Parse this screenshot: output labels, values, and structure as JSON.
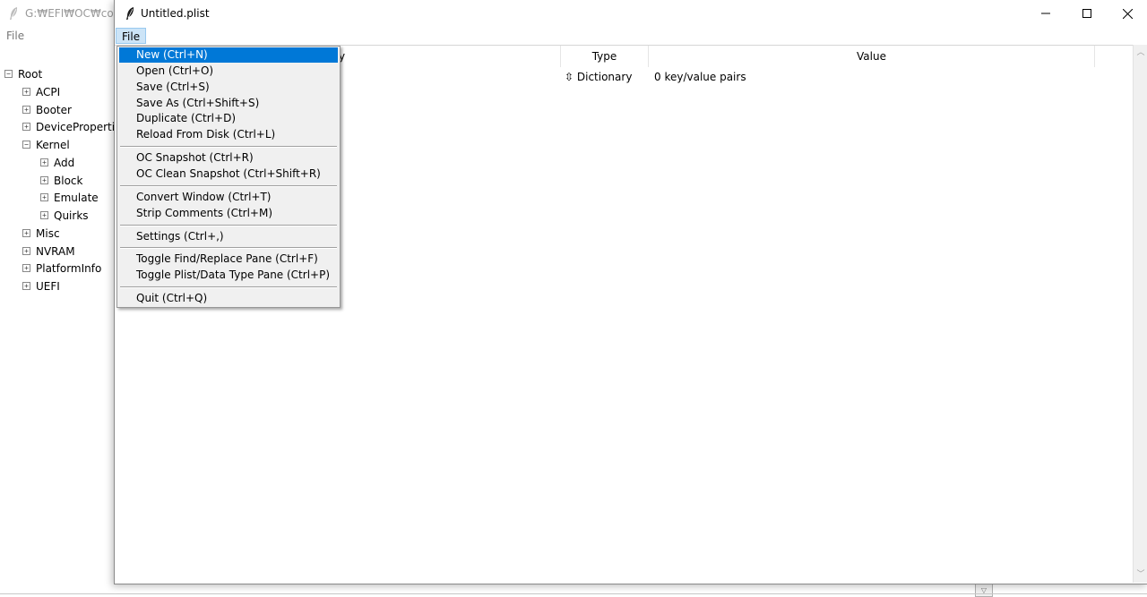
{
  "background_window": {
    "title": "G:₩EFI₩OC₩config",
    "menu_file": "File",
    "tree": [
      {
        "label": "Root",
        "toggle": "⊟",
        "level": 0
      },
      {
        "label": "ACPI",
        "toggle": "⊞",
        "level": 1
      },
      {
        "label": "Booter",
        "toggle": "⊞",
        "level": 1
      },
      {
        "label": "DeviceProperties",
        "toggle": "⊞",
        "level": 1
      },
      {
        "label": "Kernel",
        "toggle": "⊟",
        "level": 1
      },
      {
        "label": "Add",
        "toggle": "⊞",
        "level": 2
      },
      {
        "label": "Block",
        "toggle": "⊞",
        "level": 2
      },
      {
        "label": "Emulate",
        "toggle": "⊞",
        "level": 2
      },
      {
        "label": "Quirks",
        "toggle": "⊞",
        "level": 2
      },
      {
        "label": "Misc",
        "toggle": "⊞",
        "level": 1
      },
      {
        "label": "NVRAM",
        "toggle": "⊞",
        "level": 1
      },
      {
        "label": "PlatformInfo",
        "toggle": "⊞",
        "level": 1
      },
      {
        "label": "UEFI",
        "toggle": "⊞",
        "level": 1
      }
    ]
  },
  "window": {
    "title": "Untitled.plist",
    "menu_file": "File"
  },
  "table": {
    "headers": {
      "key": "y",
      "type": "Type",
      "value": "Value"
    },
    "rows": [
      {
        "type": "⇳ Dictionary",
        "value": "0 key/value pairs"
      }
    ]
  },
  "file_menu": {
    "items": [
      {
        "label": "New (Ctrl+N)",
        "active": true
      },
      {
        "label": "Open (Ctrl+O)"
      },
      {
        "label": "Save (Ctrl+S)"
      },
      {
        "label": "Save As (Ctrl+Shift+S)"
      },
      {
        "label": "Duplicate (Ctrl+D)"
      },
      {
        "label": "Reload From Disk (Ctrl+L)"
      },
      {
        "separator": true
      },
      {
        "label": "OC Snapshot (Ctrl+R)"
      },
      {
        "label": "OC Clean Snapshot (Ctrl+Shift+R)"
      },
      {
        "separator": true
      },
      {
        "label": "Convert Window (Ctrl+T)"
      },
      {
        "label": "Strip Comments (Ctrl+M)"
      },
      {
        "separator": true
      },
      {
        "label": "Settings (Ctrl+,)"
      },
      {
        "separator": true
      },
      {
        "label": "Toggle Find/Replace Pane (Ctrl+F)"
      },
      {
        "label": "Toggle Plist/Data Type Pane (Ctrl+P)"
      },
      {
        "separator": true
      },
      {
        "label": "Quit (Ctrl+Q)"
      }
    ]
  },
  "colors": {
    "menu_highlight": "#0078d7",
    "menubar_active": "#cce4f7"
  }
}
